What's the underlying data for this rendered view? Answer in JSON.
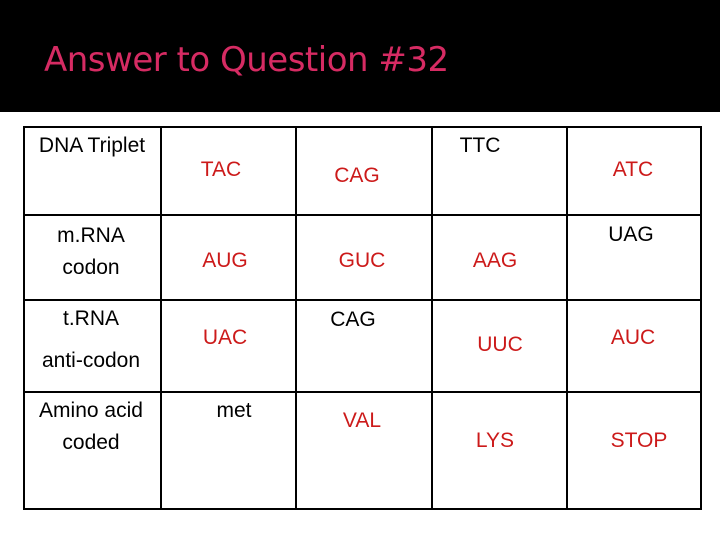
{
  "title": "Answer to Question #32",
  "colors": {
    "title": "#d62b63",
    "answer": "#cc1a1a",
    "given": "#000000",
    "header_bg": "#000000"
  },
  "rows": [
    {
      "label": [
        "DNA Triplet"
      ],
      "cells": [
        "TAC",
        "CAG",
        "TTC",
        "ATC"
      ]
    },
    {
      "label": [
        "m.RNA",
        "codon"
      ],
      "cells": [
        "AUG",
        "GUC",
        "AAG",
        "UAG"
      ]
    },
    {
      "label": [
        "t.RNA",
        "anti-codon"
      ],
      "cells": [
        "UAC",
        "CAG",
        "UUC",
        "AUC"
      ]
    },
    {
      "label": [
        "Amino acid",
        "coded"
      ],
      "cells": [
        "met",
        "VAL",
        "LYS",
        "STOP"
      ]
    }
  ]
}
